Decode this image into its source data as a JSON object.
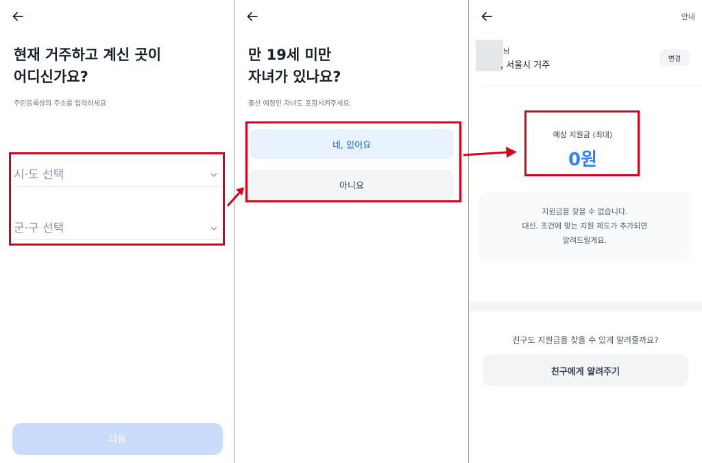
{
  "panel1": {
    "title": "현재 거주하고 계신 곳이\n어디신가요?",
    "subtitle": "주민등록상의 주소를 입력하세요",
    "city_select": "시·도 선택",
    "district_select": "군·구 선택",
    "next_button": "다음"
  },
  "panel2": {
    "title": "만 19세 미만\n자녀가 있나요?",
    "subtitle": "출산 예정인 자녀도 포함시켜주세요.",
    "yes_option": "네, 있어요",
    "no_option": "아니요"
  },
  "panel3": {
    "guide_link": "안내",
    "user_suffix": "님",
    "location": ", 서울시 거주",
    "change_button": "변경",
    "estimate_label": "예상 지원금 (최대)",
    "estimate_value": "0원",
    "notice": "지원금을 찾을 수 없습니다.\n대신, 조건에 맞는 지원 제도가 추가되면\n알려드릴게요.",
    "share_question": "친구도 지원금을 찾을 수 있게 알려줄까요?",
    "share_button": "친구에게 알려주기"
  },
  "icons": {
    "back": "arrow-left-icon",
    "chevron": "chevron-down-icon"
  },
  "colors": {
    "highlight": "#d9001b",
    "primary": "#3182f6",
    "primary_disabled": "#c9dcfb",
    "option_yes_bg": "#e8f3ff"
  }
}
